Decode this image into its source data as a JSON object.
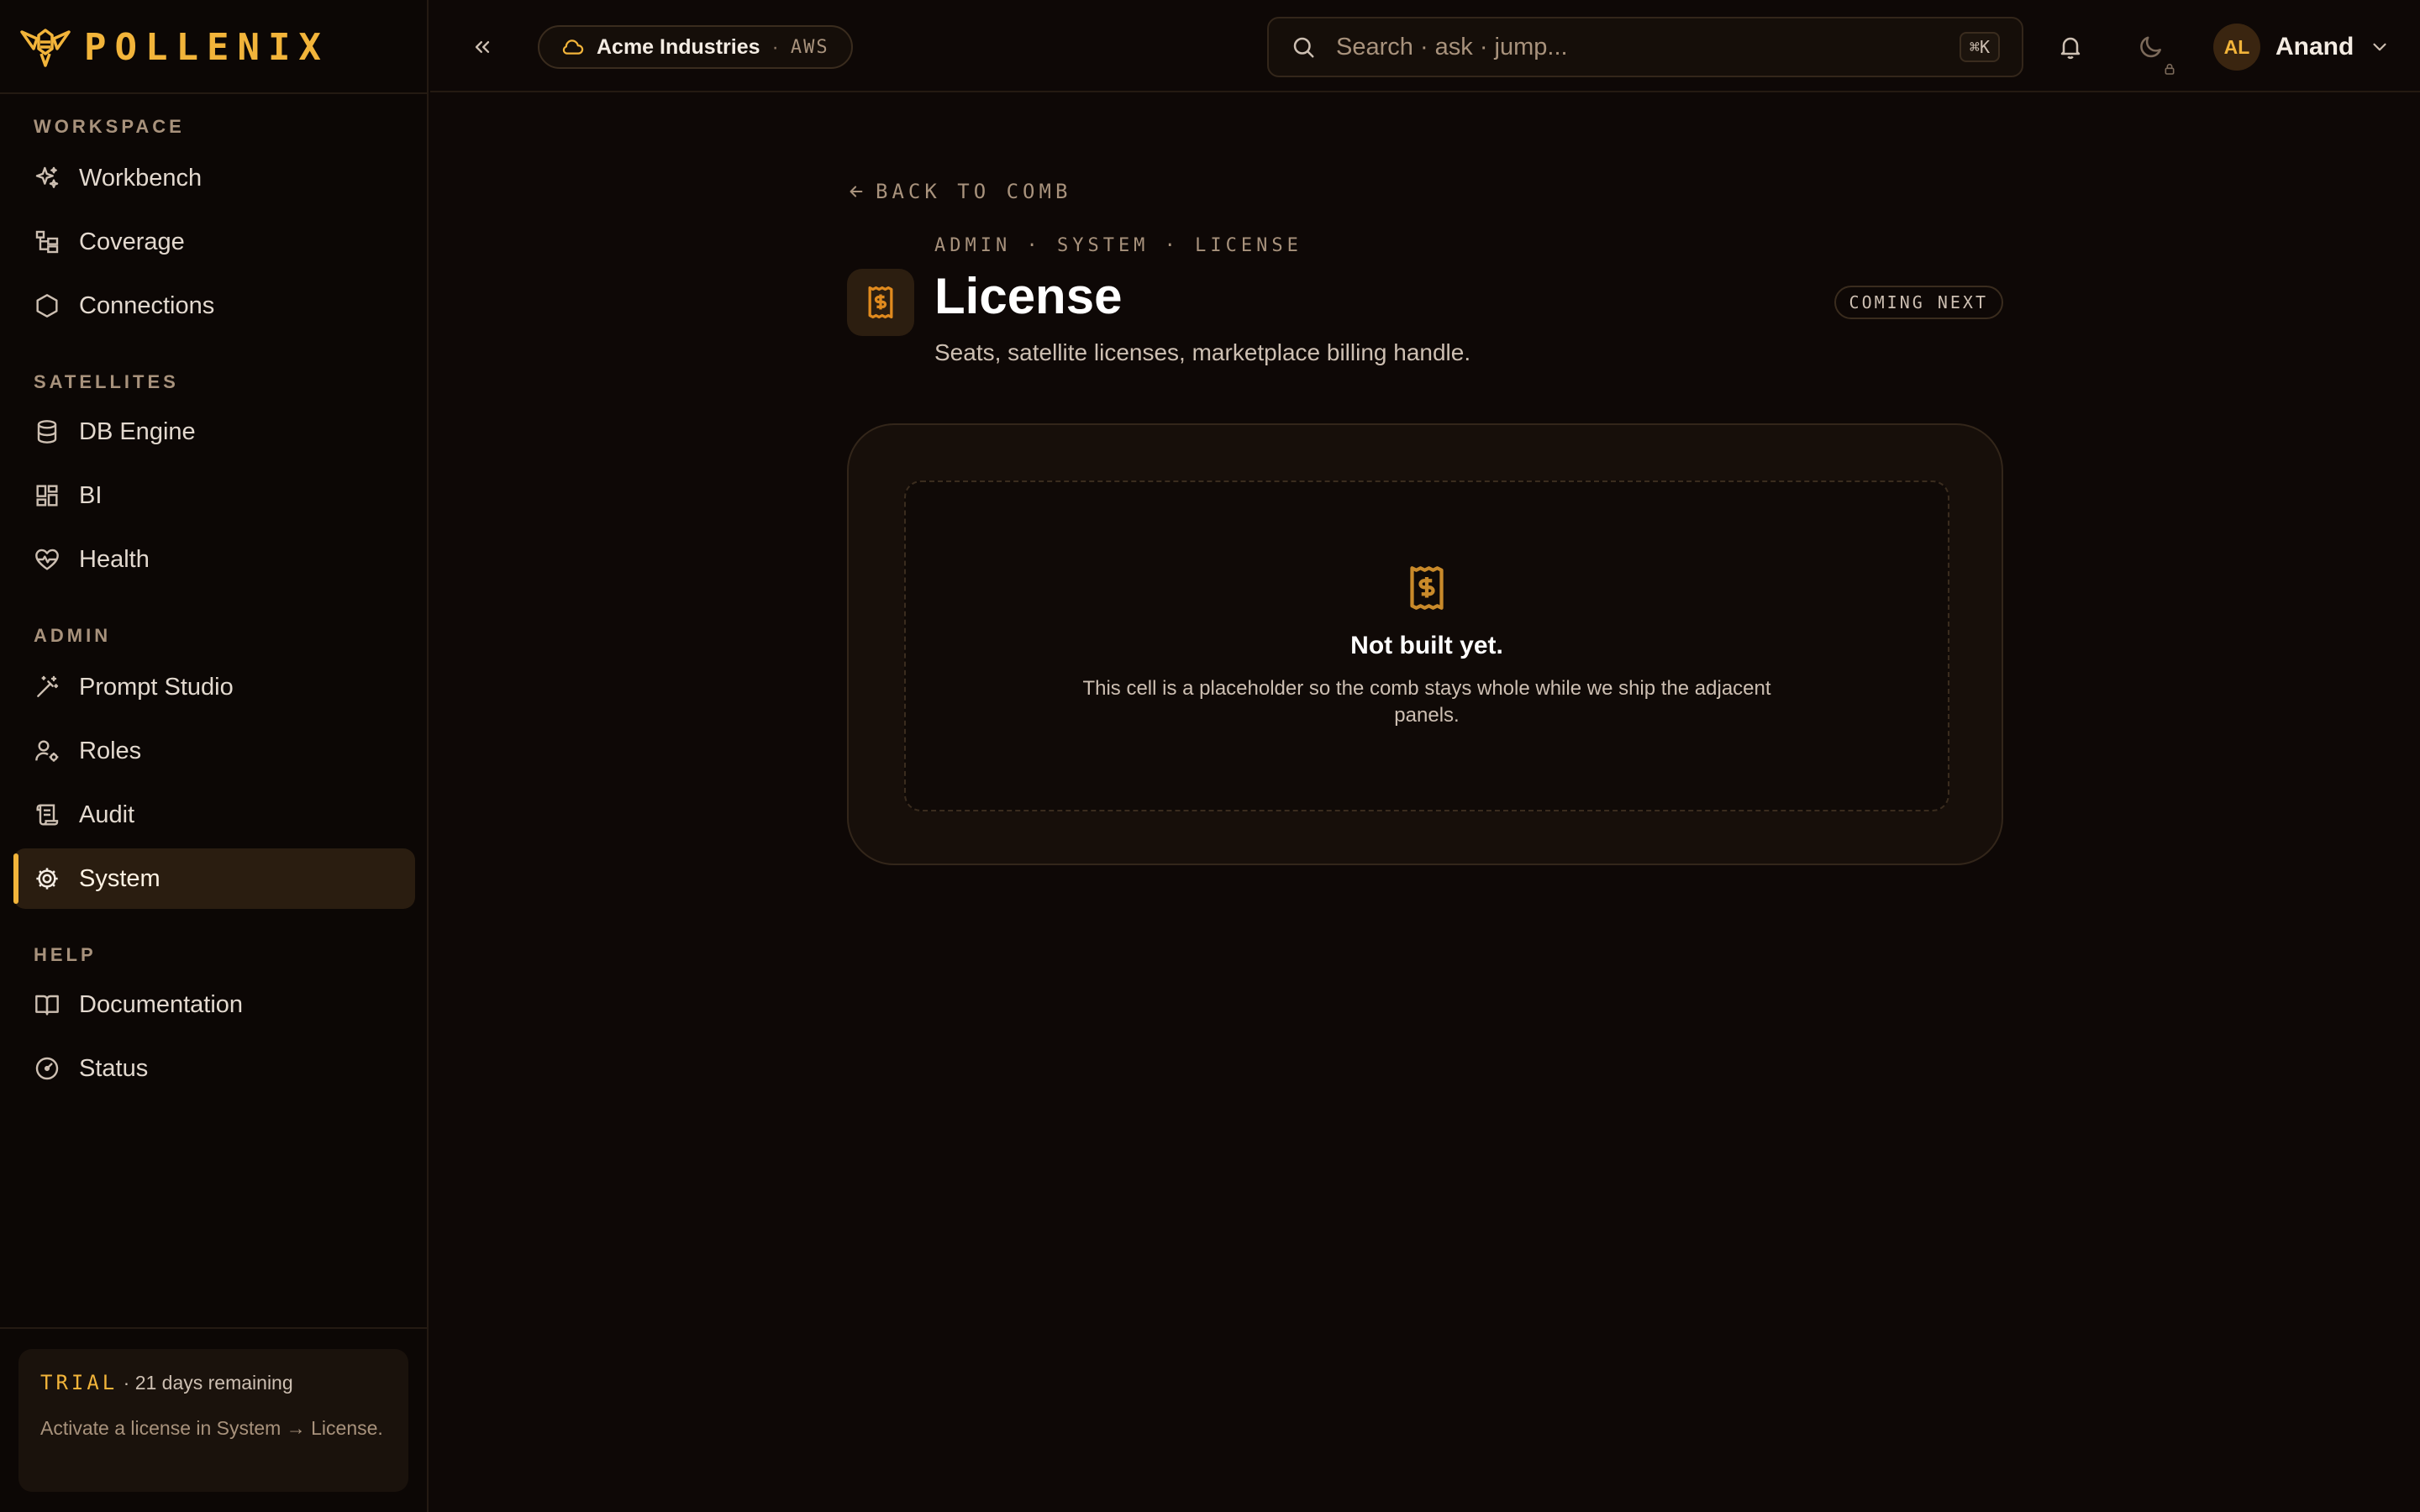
{
  "brand": {
    "name": "POLLENIX",
    "accent": "#f2b43a"
  },
  "sidebar": {
    "sections": [
      {
        "label": "WORKSPACE",
        "items": [
          {
            "label": "Workbench",
            "icon": "sparkles-icon"
          },
          {
            "label": "Coverage",
            "icon": "tree-icon"
          },
          {
            "label": "Connections",
            "icon": "hexagon-icon"
          }
        ]
      },
      {
        "label": "SATELLITES",
        "items": [
          {
            "label": "DB Engine",
            "icon": "database-icon"
          },
          {
            "label": "BI",
            "icon": "dashboard-icon"
          },
          {
            "label": "Health",
            "icon": "heart-pulse-icon"
          }
        ]
      },
      {
        "label": "ADMIN",
        "items": [
          {
            "label": "Prompt Studio",
            "icon": "wand-icon"
          },
          {
            "label": "Roles",
            "icon": "user-cog-icon"
          },
          {
            "label": "Audit",
            "icon": "scroll-icon"
          },
          {
            "label": "System",
            "icon": "gear-icon",
            "active": true
          }
        ]
      },
      {
        "label": "HELP",
        "items": [
          {
            "label": "Documentation",
            "icon": "book-icon"
          },
          {
            "label": "Status",
            "icon": "gauge-icon"
          }
        ]
      }
    ],
    "trial": {
      "tag": "TRIAL",
      "remaining": "· 21 days remaining",
      "message": "Activate a license in System → License."
    }
  },
  "topbar": {
    "tenant": {
      "name": "Acme Industries",
      "separator": "·",
      "cloud": "AWS"
    },
    "search": {
      "placeholder": "Search · ask · jump...",
      "shortcut": "⌘K"
    },
    "user": {
      "initials": "AL",
      "name": "Anand"
    }
  },
  "main": {
    "back_label": "BACK TO COMB",
    "breadcrumb": "ADMIN · SYSTEM · LICENSE",
    "title": "License",
    "subtitle": "Seats, satellite licenses, marketplace billing handle.",
    "badge": "COMING NEXT",
    "placeholder": {
      "title": "Not built yet.",
      "text": "This cell is a placeholder so the comb stays whole while we ship the adjacent panels."
    }
  }
}
